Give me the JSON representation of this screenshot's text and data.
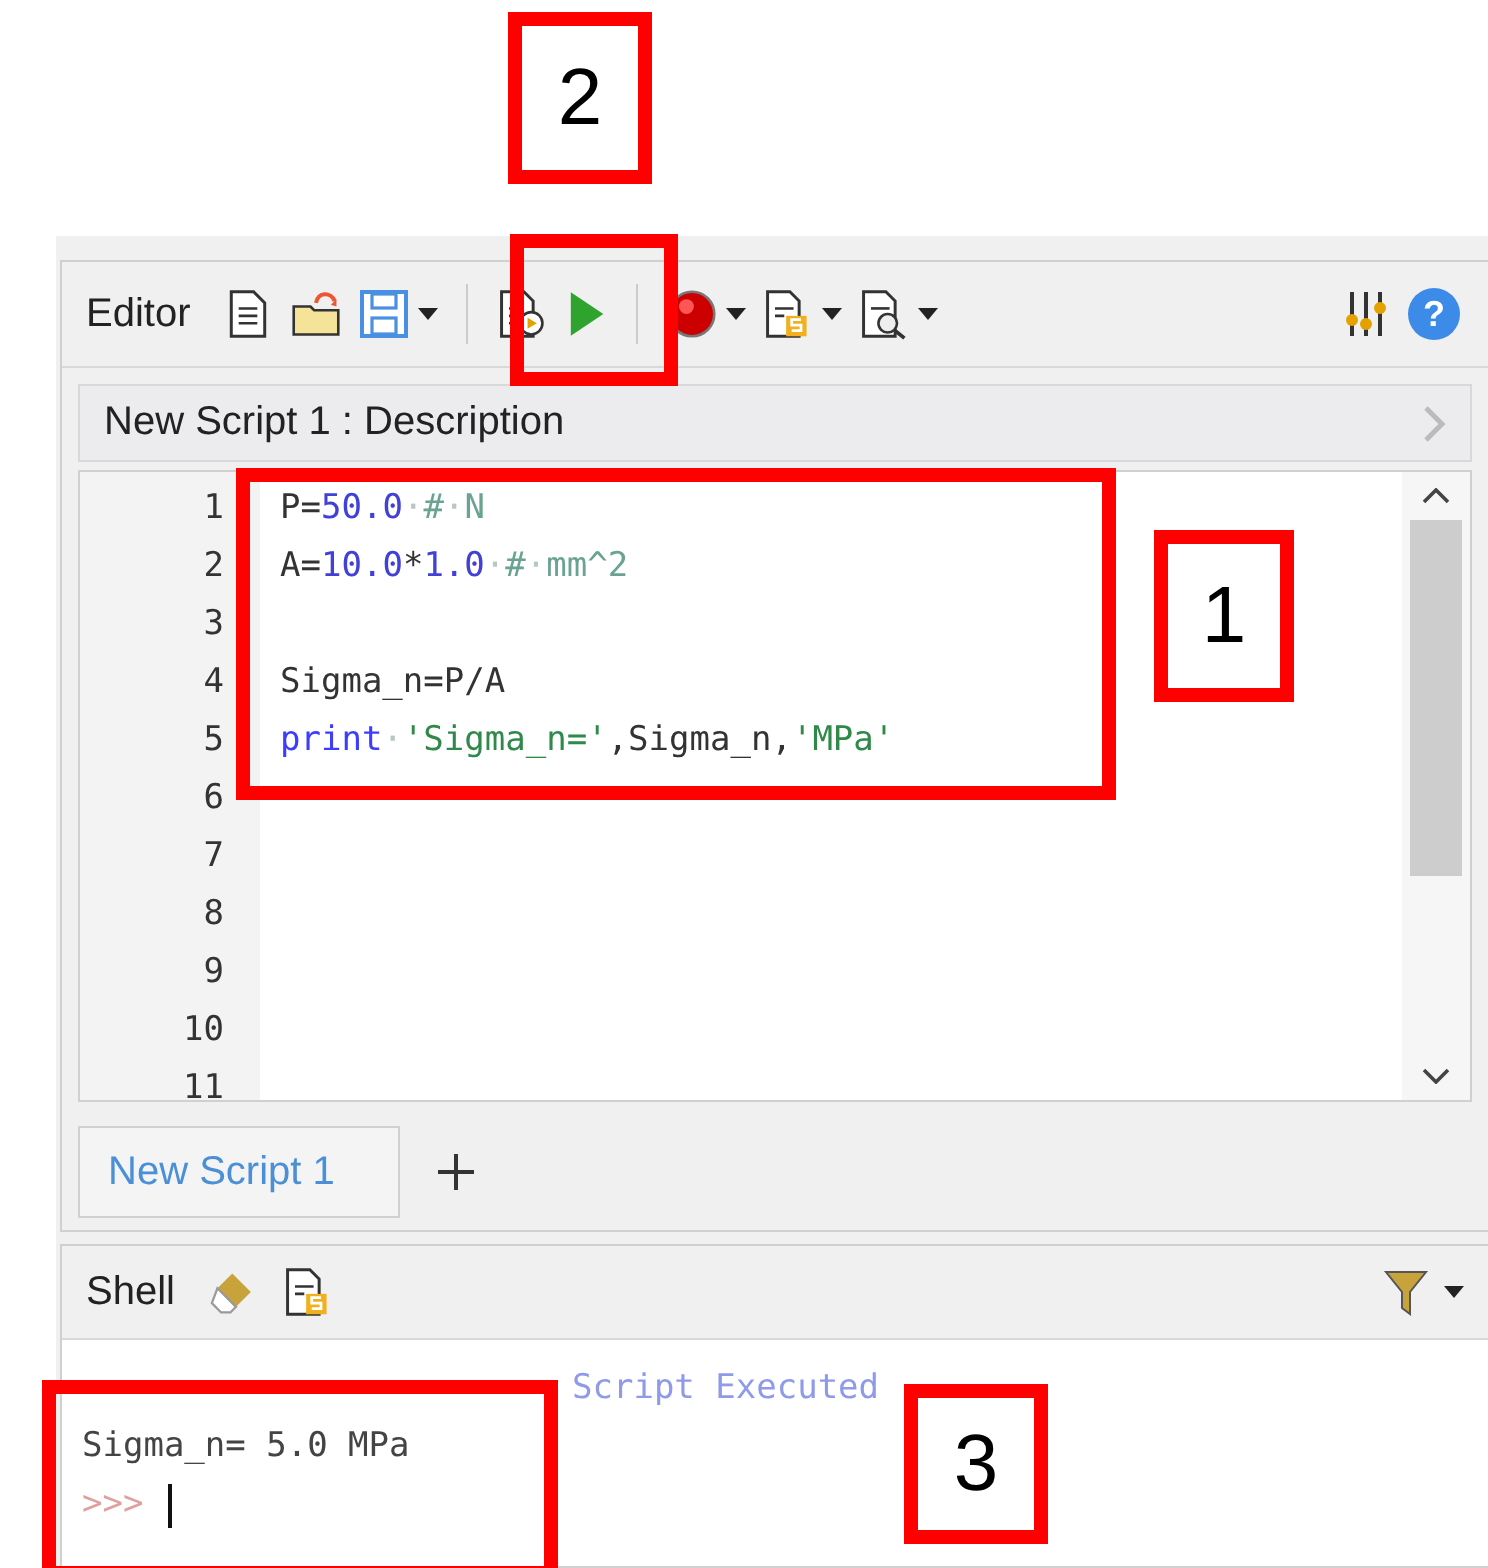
{
  "toolbar": {
    "title": "Editor",
    "help_glyph": "?"
  },
  "description_bar": {
    "text": "New Script 1 : Description"
  },
  "code": {
    "lines": [
      {
        "number": "1",
        "tokens": [
          {
            "kind": "name",
            "text": "P"
          },
          {
            "kind": "op",
            "text": "="
          },
          {
            "kind": "number",
            "text": "50.0"
          },
          {
            "kind": "ws",
            "text": "·"
          },
          {
            "kind": "comment",
            "text": "#"
          },
          {
            "kind": "ws",
            "text": "·"
          },
          {
            "kind": "comment",
            "text": "N"
          }
        ]
      },
      {
        "number": "2",
        "tokens": [
          {
            "kind": "name",
            "text": "A"
          },
          {
            "kind": "op",
            "text": "="
          },
          {
            "kind": "number",
            "text": "10.0"
          },
          {
            "kind": "op",
            "text": "*"
          },
          {
            "kind": "number",
            "text": "1.0"
          },
          {
            "kind": "ws",
            "text": "·"
          },
          {
            "kind": "comment",
            "text": "#"
          },
          {
            "kind": "ws",
            "text": "·"
          },
          {
            "kind": "comment",
            "text": "mm^2"
          }
        ]
      },
      {
        "number": "3"
      },
      {
        "number": "4",
        "tokens": [
          {
            "kind": "name",
            "text": "Sigma_n=P/A"
          }
        ]
      },
      {
        "number": "5",
        "tokens": [
          {
            "kind": "keyword",
            "text": "print"
          },
          {
            "kind": "ws",
            "text": "·"
          },
          {
            "kind": "string",
            "text": "'Sigma_n='"
          },
          {
            "kind": "op",
            "text": ","
          },
          {
            "kind": "name",
            "text": "Sigma_n"
          },
          {
            "kind": "op",
            "text": ","
          },
          {
            "kind": "string",
            "text": "'MPa'"
          }
        ]
      },
      {
        "number": "6"
      },
      {
        "number": "7"
      },
      {
        "number": "8"
      },
      {
        "number": "9"
      },
      {
        "number": "10"
      },
      {
        "number": "11"
      }
    ]
  },
  "tabs": [
    {
      "label": "New Script 1",
      "selected": true
    }
  ],
  "shell": {
    "title": "Shell",
    "lines": [
      {
        "kind": "info",
        "text": "Script Executed"
      },
      {
        "kind": "output",
        "text": "Sigma_n= 5.0 MPa"
      },
      {
        "kind": "prompt",
        "text": ">>>"
      }
    ]
  },
  "annotations": [
    {
      "label": "1"
    },
    {
      "label": "2"
    },
    {
      "label": "3"
    }
  ]
}
